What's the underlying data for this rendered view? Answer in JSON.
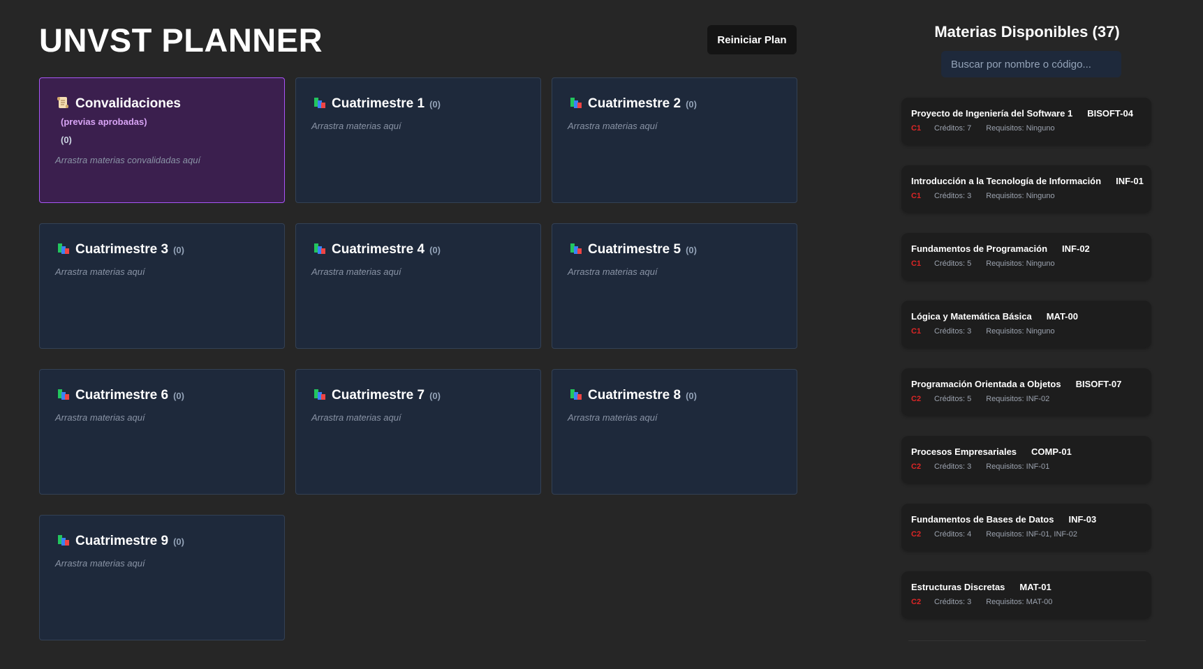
{
  "app": {
    "title": "UNVST PLANNER",
    "reset_label": "Reiniciar Plan"
  },
  "convalidaciones": {
    "title": "Convalidaciones",
    "subtitle": "(previas aprobadas)",
    "count": "(0)",
    "hint": "Arrastra materias convalidadas aquí",
    "icon": "scroll-icon"
  },
  "semesters": [
    {
      "title": "Cuatrimestre 1",
      "count": "(0)",
      "hint": "Arrastra materias aquí",
      "icon": "books-icon"
    },
    {
      "title": "Cuatrimestre 2",
      "count": "(0)",
      "hint": "Arrastra materias aquí",
      "icon": "books-icon"
    },
    {
      "title": "Cuatrimestre 3",
      "count": "(0)",
      "hint": "Arrastra materias aquí",
      "icon": "books-icon"
    },
    {
      "title": "Cuatrimestre 4",
      "count": "(0)",
      "hint": "Arrastra materias aquí",
      "icon": "books-icon"
    },
    {
      "title": "Cuatrimestre 5",
      "count": "(0)",
      "hint": "Arrastra materias aquí",
      "icon": "books-icon"
    },
    {
      "title": "Cuatrimestre 6",
      "count": "(0)",
      "hint": "Arrastra materias aquí",
      "icon": "books-icon"
    },
    {
      "title": "Cuatrimestre 7",
      "count": "(0)",
      "hint": "Arrastra materias aquí",
      "icon": "books-icon"
    },
    {
      "title": "Cuatrimestre 8",
      "count": "(0)",
      "hint": "Arrastra materias aquí",
      "icon": "books-icon"
    },
    {
      "title": "Cuatrimestre 9",
      "count": "(0)",
      "hint": "Arrastra materias aquí",
      "icon": "books-icon"
    }
  ],
  "sidebar": {
    "title": "Materias Disponibles (37)",
    "search_placeholder": "Buscar por nombre o código...",
    "subjects": [
      {
        "name": "Proyecto de Ingeniería del Software 1",
        "code": "BISOFT-04",
        "semester": "C1",
        "credits": "Créditos: 7",
        "requirements": "Requisitos: Ninguno"
      },
      {
        "name": "Introducción a la Tecnología de Información",
        "code": "INF-01",
        "semester": "C1",
        "credits": "Créditos: 3",
        "requirements": "Requisitos: Ninguno"
      },
      {
        "name": "Fundamentos de Programación",
        "code": "INF-02",
        "semester": "C1",
        "credits": "Créditos: 5",
        "requirements": "Requisitos: Ninguno"
      },
      {
        "name": "Lógica y Matemática Básica",
        "code": "MAT-00",
        "semester": "C1",
        "credits": "Créditos: 3",
        "requirements": "Requisitos: Ninguno"
      },
      {
        "name": "Programación Orientada a Objetos",
        "code": "BISOFT-07",
        "semester": "C2",
        "credits": "Créditos: 5",
        "requirements": "Requisitos: INF-02"
      },
      {
        "name": "Procesos Empresariales",
        "code": "COMP-01",
        "semester": "C2",
        "credits": "Créditos: 3",
        "requirements": "Requisitos: INF-01"
      },
      {
        "name": "Fundamentos de Bases de Datos",
        "code": "INF-03",
        "semester": "C2",
        "credits": "Créditos: 4",
        "requirements": "Requisitos: INF-01, INF-02"
      },
      {
        "name": "Estructuras Discretas",
        "code": "MAT-01",
        "semester": "C2",
        "credits": "Créditos: 3",
        "requirements": "Requisitos: MAT-00"
      }
    ]
  },
  "colors": {
    "background": "#262626",
    "card_bg": "#1e293b",
    "convalidaciones_bg": "#3b1f4e",
    "convalidaciones_border": "#a855f7",
    "semester_tag": "#dc2626"
  }
}
